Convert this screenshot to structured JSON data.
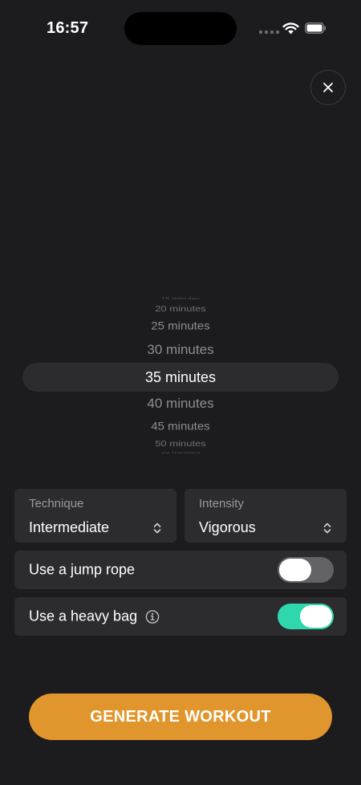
{
  "status_bar": {
    "time": "16:57"
  },
  "close_button": {
    "icon": "close-icon"
  },
  "duration_picker": {
    "options": [
      "15 minutes",
      "20 minutes",
      "25 minutes",
      "30 minutes",
      "35 minutes",
      "40 minutes",
      "45 minutes",
      "50 minutes",
      "55 minutes"
    ],
    "selected": "35 minutes"
  },
  "technique": {
    "label": "Technique",
    "value": "Intermediate"
  },
  "intensity": {
    "label": "Intensity",
    "value": "Vigorous"
  },
  "jump_rope": {
    "label": "Use a jump rope",
    "enabled": false
  },
  "heavy_bag": {
    "label": "Use a heavy bag",
    "enabled": true
  },
  "generate_button": {
    "label": "GENERATE WORKOUT"
  },
  "colors": {
    "background": "#1c1c1e",
    "card": "#2c2c2e",
    "accent_orange": "#e0962c",
    "toggle_on": "#2fd8ac",
    "toggle_off": "#636366"
  }
}
